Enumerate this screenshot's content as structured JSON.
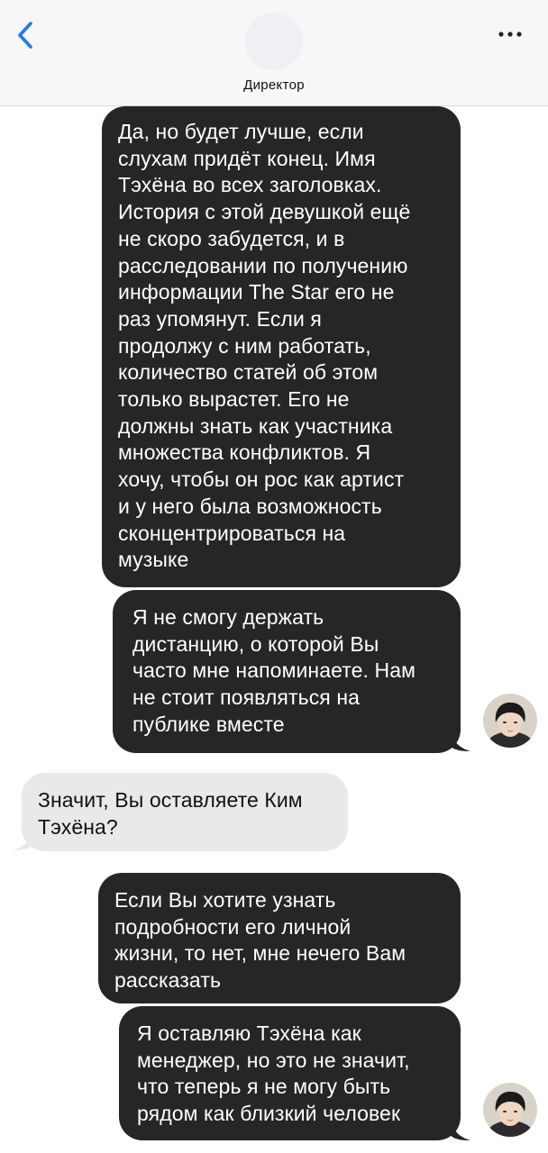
{
  "header": {
    "title": "Директор",
    "back_icon": "chevron-left-icon",
    "more_icon": "ellipsis-icon"
  },
  "colors": {
    "accent": "#1a7cf5",
    "outgoing_bubble": "#262629",
    "incoming_bubble": "#e9e9eb"
  },
  "messages": [
    {
      "sender": "me",
      "text": "Да, но будет лучше, если\nслухам придёт конец. Имя\nТэхёна во всех заголовках.\nИстория с этой девушкой ещё\nне скоро забудется, и в\nрасследовании по получению\nинформации The Star его не\nраз упомянут. Если я\nпродолжу с ним работать,\nколичество статей об этом\nтолько вырастет. Его не\nдолжны знать как участника\nмножества конфликтов. Я\nхочу, чтобы он рос как артист\nи у него была возможность\nсконцентрироваться на\nмузыке"
    },
    {
      "sender": "me",
      "text": "Я не смогу держать\nдистанцию, о которой Вы\nчасто мне напоминаете. Нам\nне стоит появляться на\nпублике вместе"
    },
    {
      "sender": "director",
      "text": "Значит, Вы оставляете Ким\nТэхёна?"
    },
    {
      "sender": "me",
      "text": "Если Вы хотите узнать\nподробности его личной\nжизни, то нет, мне нечего Вам\nрассказать"
    },
    {
      "sender": "me",
      "text": "Я оставляю Тэхёна как\nменеджер, но это не значит,\nчто теперь я не могу быть\nрядом как близкий человек"
    }
  ]
}
